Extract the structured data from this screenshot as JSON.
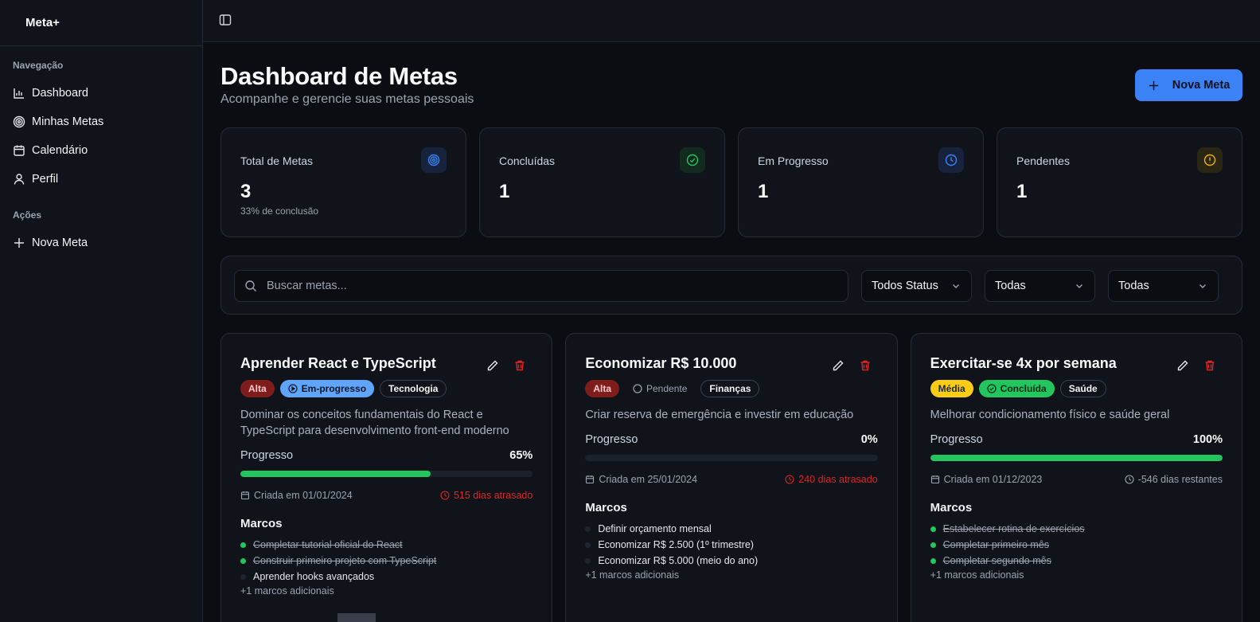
{
  "sidebar": {
    "brand": "Meta+",
    "nav_heading": "Navegação",
    "nav_items": [
      {
        "label": "Dashboard",
        "icon": "bar-chart-icon"
      },
      {
        "label": "Minhas Metas",
        "icon": "target-icon"
      },
      {
        "label": "Calendário",
        "icon": "calendar-icon"
      },
      {
        "label": "Perfil",
        "icon": "user-icon"
      }
    ],
    "actions_heading": "Ações",
    "action_items": [
      {
        "label": "Nova Meta",
        "icon": "plus-icon"
      }
    ]
  },
  "header": {
    "title": "Dashboard de Metas",
    "subtitle": "Acompanhe e gerencie suas metas pessoais",
    "new_goal_label": "Nova Meta"
  },
  "stats": [
    {
      "label": "Total de Metas",
      "value": "3",
      "sub": "33% de conclusão",
      "icon": "target-icon",
      "color": "#3b82f6"
    },
    {
      "label": "Concluídas",
      "value": "1",
      "sub": "",
      "icon": "check-circle-icon",
      "color": "#22c55e"
    },
    {
      "label": "Em Progresso",
      "value": "1",
      "sub": "",
      "icon": "clock-icon",
      "color": "#3b82f6"
    },
    {
      "label": "Pendentes",
      "value": "1",
      "sub": "",
      "icon": "alert-circle-icon",
      "color": "#eab308"
    }
  ],
  "filters": {
    "search_placeholder": "Buscar metas...",
    "status_value": "Todos Status",
    "priority_value": "Todas",
    "category_value": "Todas"
  },
  "goals": [
    {
      "title": "Aprender React e TypeScript",
      "priority": "Alta",
      "status": "Em-progresso",
      "category": "Tecnologia",
      "description": "Dominar os conceitos fundamentais do React e TypeScript para desenvolvimento front-end moderno",
      "progress_label": "Progresso",
      "progress": 65,
      "progress_text": "65%",
      "created": "Criada em 01/01/2024",
      "deadline": "515 dias atrasado",
      "milestones_title": "Marcos",
      "milestones": [
        {
          "text": "Completar tutorial oficial do React",
          "done": true
        },
        {
          "text": "Construir primeiro projeto com TypeScript",
          "done": true
        },
        {
          "text": "Aprender hooks avançados",
          "done": false
        }
      ],
      "more": "+1 marcos adicionais"
    },
    {
      "title": "Economizar R$ 10.000",
      "priority": "Alta",
      "status": "Pendente",
      "category": "Finanças",
      "description": "Criar reserva de emergência e investir em educação",
      "progress_label": "Progresso",
      "progress": 0,
      "progress_text": "0%",
      "created": "Criada em 25/01/2024",
      "deadline": "240 dias atrasado",
      "milestones_title": "Marcos",
      "milestones": [
        {
          "text": "Definir orçamento mensal",
          "done": false
        },
        {
          "text": "Economizar R$ 2.500 (1º trimestre)",
          "done": false
        },
        {
          "text": "Economizar R$ 5.000 (meio do ano)",
          "done": false
        }
      ],
      "more": "+1 marcos adicionais"
    },
    {
      "title": "Exercitar-se 4x por semana",
      "priority": "Média",
      "status": "Concluída",
      "category": "Saúde",
      "description": "Melhorar condicionamento físico e saúde geral",
      "progress_label": "Progresso",
      "progress": 100,
      "progress_text": "100%",
      "created": "Criada em 01/12/2023",
      "deadline": "-546 dias restantes",
      "milestones_title": "Marcos",
      "milestones": [
        {
          "text": "Estabelecer rotina de exercícios",
          "done": true
        },
        {
          "text": "Completar primeiro mês",
          "done": true
        },
        {
          "text": "Completar segundo mês",
          "done": true
        }
      ],
      "more": "+1 marcos adicionais"
    }
  ]
}
